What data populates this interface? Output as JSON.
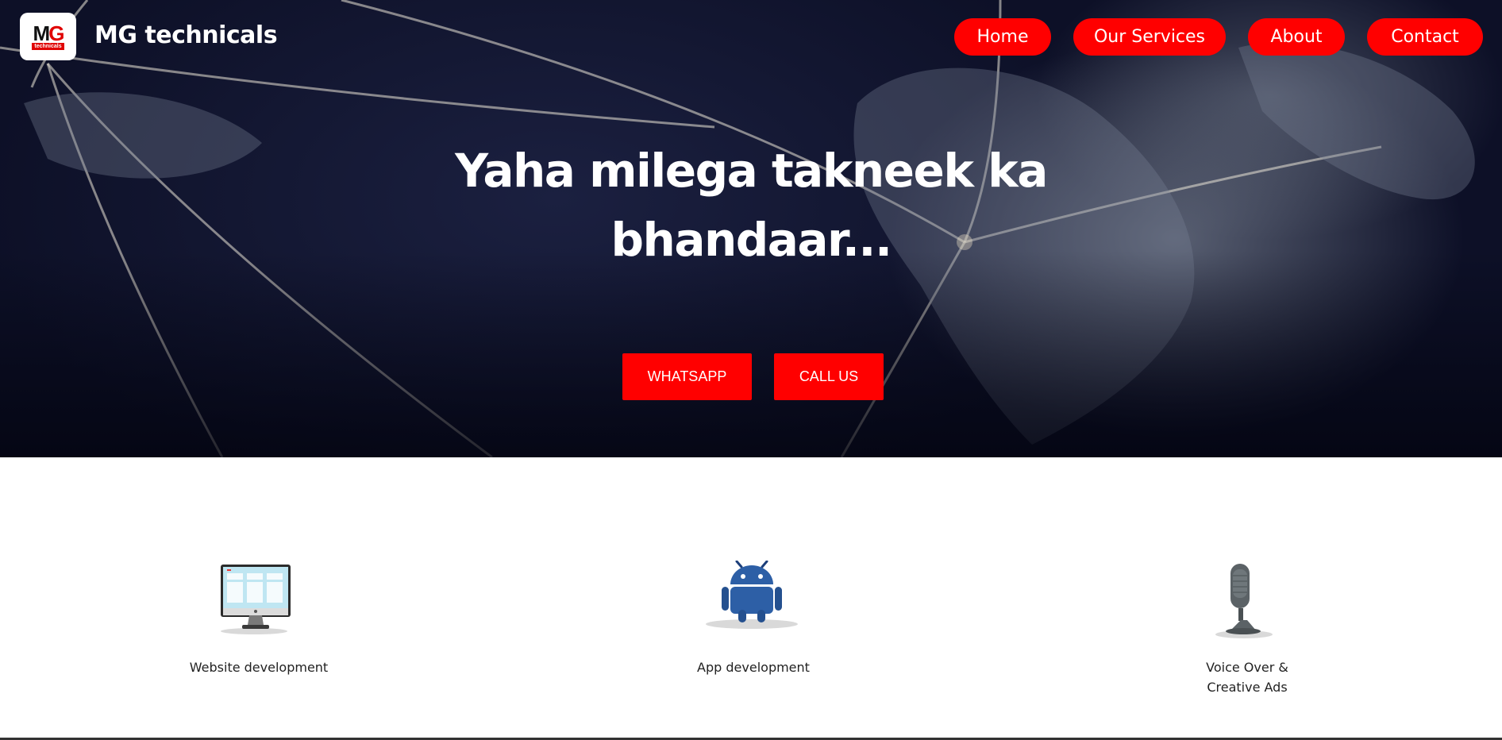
{
  "brand": {
    "logo_big_m": "M",
    "logo_big_g": "G",
    "logo_small": "technicals",
    "name": "MG technicals"
  },
  "nav": {
    "items": [
      {
        "label": "Home"
      },
      {
        "label": "Our Services"
      },
      {
        "label": "About"
      },
      {
        "label": "Contact"
      }
    ]
  },
  "hero": {
    "headline_line1": "Yaha milega takneek ka",
    "headline_line2": "bhandaar...",
    "buttons": [
      {
        "label": "WHATSAPP"
      },
      {
        "label": "CALL US"
      }
    ]
  },
  "services": [
    {
      "label": "Website development",
      "icon": "desktop-computer-icon"
    },
    {
      "label": "App development",
      "icon": "android-robot-icon"
    },
    {
      "label_line1": "Voice Over &",
      "label_line2": "Creative Ads",
      "icon": "microphone-icon"
    }
  ],
  "colors": {
    "accent": "#ff0000",
    "hero_bg": "#0d1027",
    "text": "#222222"
  }
}
